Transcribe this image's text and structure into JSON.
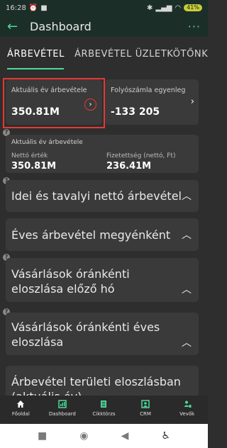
{
  "status": {
    "time": "16:28",
    "battery": "41"
  },
  "appbar": {
    "title": "Dashboard",
    "more_label": "···"
  },
  "tabs": [
    {
      "label": "ÁRBEVÉTEL"
    },
    {
      "label": "ÁRBEVÉTEL ÜZLETKÖTŐNKÉN"
    }
  ],
  "kpis": [
    {
      "label": "Aktuális év árbevétele",
      "value": "350.81M"
    },
    {
      "label": "Folyószámla egyenleg",
      "value": "-133 205"
    }
  ],
  "summary": {
    "title": "Aktuális év árbevétele",
    "net_label": "Nettó érték",
    "net_value": "350.81M",
    "paid_label": "Fizetettség (nettó, Ft)",
    "paid_value": "236.41M"
  },
  "sections": [
    {
      "title": "Idei és tavalyi nettó árbevétel"
    },
    {
      "title": "Éves árbevétel megyénként"
    },
    {
      "title": "Vásárlások óránkénti eloszlása előző hó"
    },
    {
      "title": "Vásárlások óránkénti éves eloszlása"
    },
    {
      "title": "Árbevétel területi eloszlásban (aktuális év)"
    }
  ],
  "nav": [
    {
      "label": "Főoldal",
      "icon": "home-icon",
      "color": "#ffffff"
    },
    {
      "label": "Dashboard",
      "icon": "dashboard-icon",
      "color": "#4ddb9c"
    },
    {
      "label": "Cikktörzs",
      "icon": "catalog-icon",
      "color": "#4ddb9c"
    },
    {
      "label": "CRM",
      "icon": "crm-icon",
      "color": "#4ddb9c"
    },
    {
      "label": "Vevők",
      "icon": "customers-icon",
      "color": "#4ddb9c"
    }
  ],
  "colors": {
    "accent": "#4ddb9c",
    "highlight": "#e53935",
    "background": "#2e2e2e",
    "card": "#3a3a3a"
  }
}
